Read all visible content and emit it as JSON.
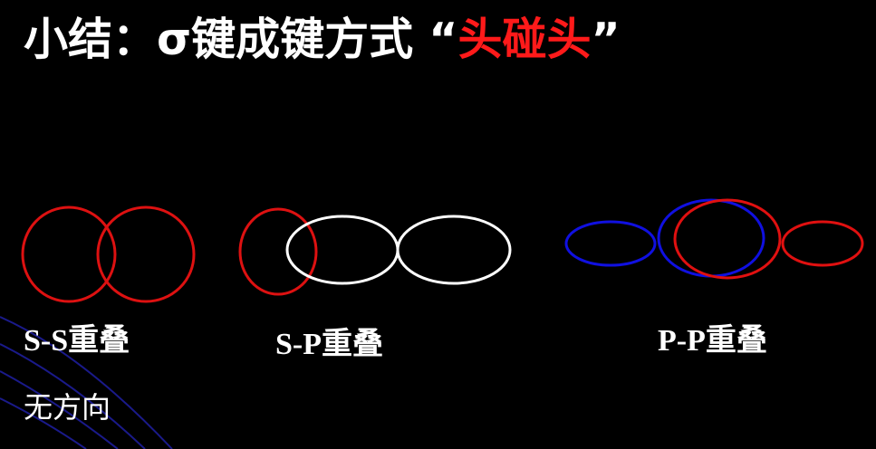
{
  "title": {
    "prefix": "小结：σ键成键方式  “",
    "highlight": "头碰头",
    "suffix": "”"
  },
  "colors": {
    "background": "#000000",
    "text": "#ffffff",
    "highlight": "#ff1a1a",
    "s_orbital": "#dd1111",
    "p_orbital_white": "#ffffff",
    "p_orbital_blue": "#1010e0",
    "p_orbital_red": "#e01010",
    "deco_lines": "#1a1a8a"
  },
  "diagrams": {
    "ss": {
      "label": "S-S重叠",
      "note": "无方向"
    },
    "sp": {
      "label": "S-P重叠"
    },
    "pp": {
      "label": "P-P重叠"
    }
  }
}
